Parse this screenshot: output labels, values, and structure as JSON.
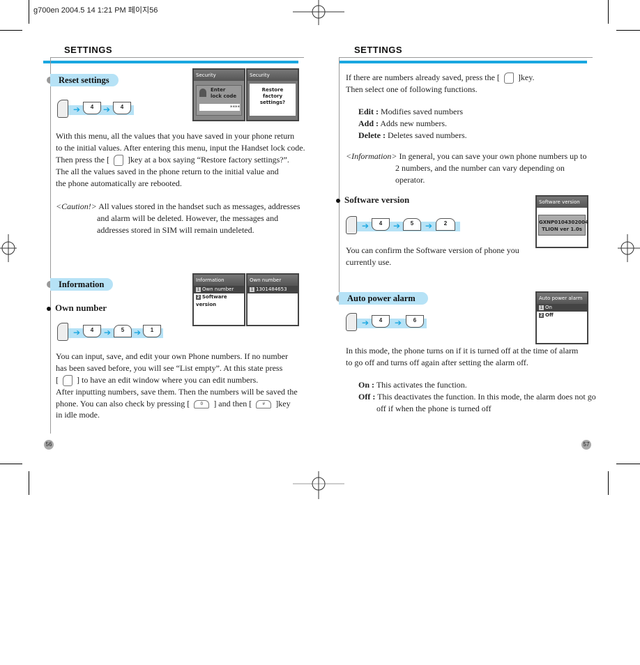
{
  "print_header": "g700en  2004.5 14 1:21 PM 페이지56",
  "left_page": {
    "title": "SETTINGS",
    "page_number": "56",
    "reset": {
      "heading": "Reset settings",
      "keys": [
        "4",
        "4"
      ],
      "screens": [
        {
          "title": "Security",
          "line1": "Enter",
          "line2": "lock code",
          "code": "****"
        },
        {
          "title": "Security",
          "line1": "Restore",
          "line2": "factory",
          "line3": "settings?"
        }
      ],
      "p1": "With this menu, all the values that you have saved in your phone return",
      "p2": "to the initial values. After entering this menu, input the Handset lock code.",
      "p3a": "Then press the [",
      "p3b": "]key at a box saying “Restore factory settings?”.",
      "p4": "The all the values saved in the phone return to the initial value and",
      "p5": "the phone automatically are rebooted.",
      "caution_label": "<Caution!>",
      "caution1": "All values stored in the handset such as messages, addresses",
      "caution2": "and alarm will be deleted. However, the messages and",
      "caution3": "addresses stored in SIM will remain undeleted."
    },
    "information": {
      "heading": "Information",
      "sub": "Own number",
      "keys": [
        "4",
        "5",
        "1"
      ],
      "screens": [
        {
          "title": "Information",
          "items": [
            "Own number",
            "Software version"
          ]
        },
        {
          "title": "Own number",
          "items": [
            "1301484653"
          ]
        }
      ],
      "p1": "You can input, save, and edit your own Phone numbers. If no number",
      "p2": "has been saved before, you will see “List empty”. At this state press",
      "p3a": "[",
      "p3b": "] to have an edit window where you can edit numbers.",
      "p4": "After inputting numbers, save them. Then the numbers will be saved the",
      "p5a": "phone. You can also check by pressing [",
      "p5b": "] and then [",
      "p5c": "]key",
      "p6": "in idle mode."
    }
  },
  "right_page": {
    "title": "SETTINGS",
    "page_number": "57",
    "intro1a": "If there are numbers already saved, press the [",
    "intro1b": "]key.",
    "intro2": "Then select one of following functions.",
    "functions": [
      {
        "label": "Edit :",
        "desc": "Modifies saved numbers"
      },
      {
        "label": "Add :",
        "desc": "Adds new numbers."
      },
      {
        "label": "Delete :",
        "desc": "Deletes saved numbers."
      }
    ],
    "info_label": "<Information>",
    "info1": "In general, you can save your own phone numbers up to",
    "info2": "2 numbers, and the number can vary depending on",
    "info3": "operator.",
    "software": {
      "sub": "Software version",
      "keys": [
        "4",
        "5",
        "2"
      ],
      "screen": {
        "title": "Software version",
        "line1": "GXNP0104302004",
        "line2": "TLION ver 1.0s"
      },
      "p1": "You can confirm the Software version of phone you",
      "p2": "currently use."
    },
    "alarm": {
      "heading": "Auto power alarm",
      "keys": [
        "4",
        "6"
      ],
      "screen": {
        "title": "Auto power alarm",
        "items": [
          "On",
          "Off"
        ]
      },
      "p1": "In this mode, the phone turns on if it is turned off at the time of alarm",
      "p2": "to go off and turns off again after setting the alarm off.",
      "on_label": "On :",
      "on_desc": "This activates the function.",
      "off_label": "Off :",
      "off_desc1": "This deactivates the function. In this mode, the alarm does not go",
      "off_desc2": "off if when the phone is turned off"
    }
  }
}
